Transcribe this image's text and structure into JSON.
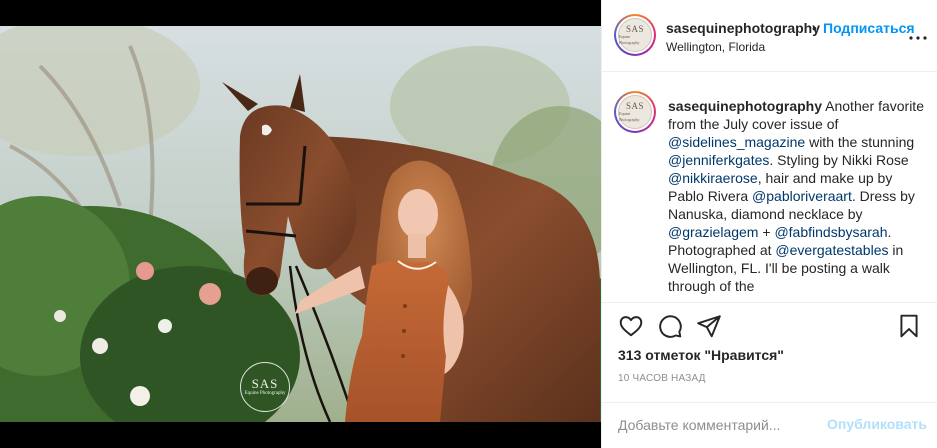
{
  "post": {
    "username": "sasequinephotography",
    "separator": "•",
    "follow_label": "Подписаться",
    "location": "Wellington, Florida",
    "avatar_text_main": "SAS",
    "avatar_text_sub": "Equine Photography",
    "watermark_main": "SAS",
    "watermark_sub": "Equine Photography"
  },
  "caption": {
    "username": "sasequinephotography",
    "t1": " Another favorite from the July cover issue of ",
    "m1": "@sidelines_magazine",
    "t2": " with the stunning ",
    "m2": "@jenniferkgates",
    "t3": ". Styling by Nikki Rose ",
    "m3": "@nikkiraerose",
    "t4": ", hair and make up by Pablo Rivera ",
    "m4": "@pabloriveraart",
    "t5": ". Dress by Nanuska, diamond necklace by ",
    "m5": "@grazielagem",
    "t6": " + ",
    "m6": "@fabfindsbysarah",
    "t7": ". Photographed at ",
    "m7": "@evergatestables",
    "t8": " in Wellington, FL. I'll be posting a walk through of the"
  },
  "stats": {
    "likes": "313 отметок \"Нравится\"",
    "time": "10 часов назад"
  },
  "comment": {
    "placeholder": "Добавьте комментарий...",
    "publish_label": "Опубликовать"
  },
  "icons": {
    "like": "heart-icon",
    "comment": "comment-icon",
    "share": "paper-plane-icon",
    "save": "bookmark-icon",
    "more": "more-horizontal-icon"
  }
}
